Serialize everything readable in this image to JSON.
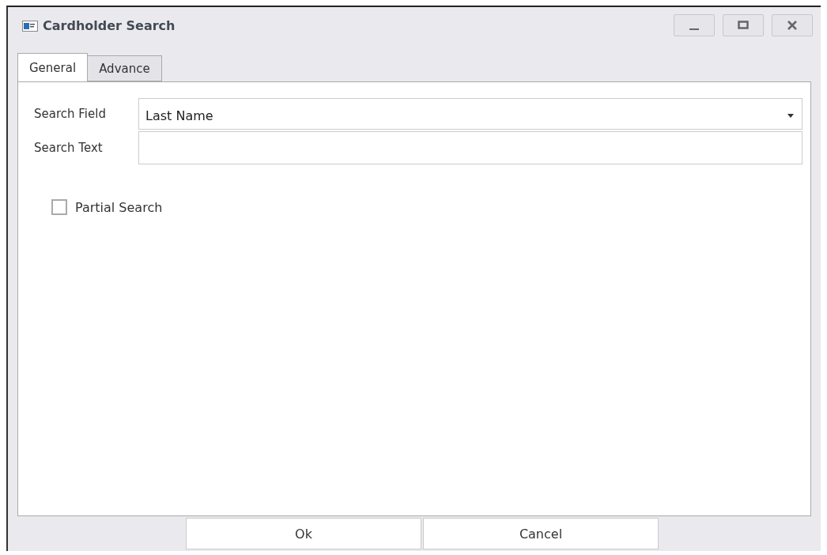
{
  "window": {
    "title": "Cardholder Search"
  },
  "tabs": [
    {
      "label": "General",
      "selected": true
    },
    {
      "label": "Advance",
      "selected": false
    }
  ],
  "form": {
    "search_field": {
      "label": "Search Field",
      "value": "Last Name"
    },
    "search_text": {
      "label": "Search Text"
    },
    "partial_search": {
      "label": "Partial Search",
      "checked": false
    }
  },
  "buttons": [
    "Ok",
    "Cancel"
  ]
}
